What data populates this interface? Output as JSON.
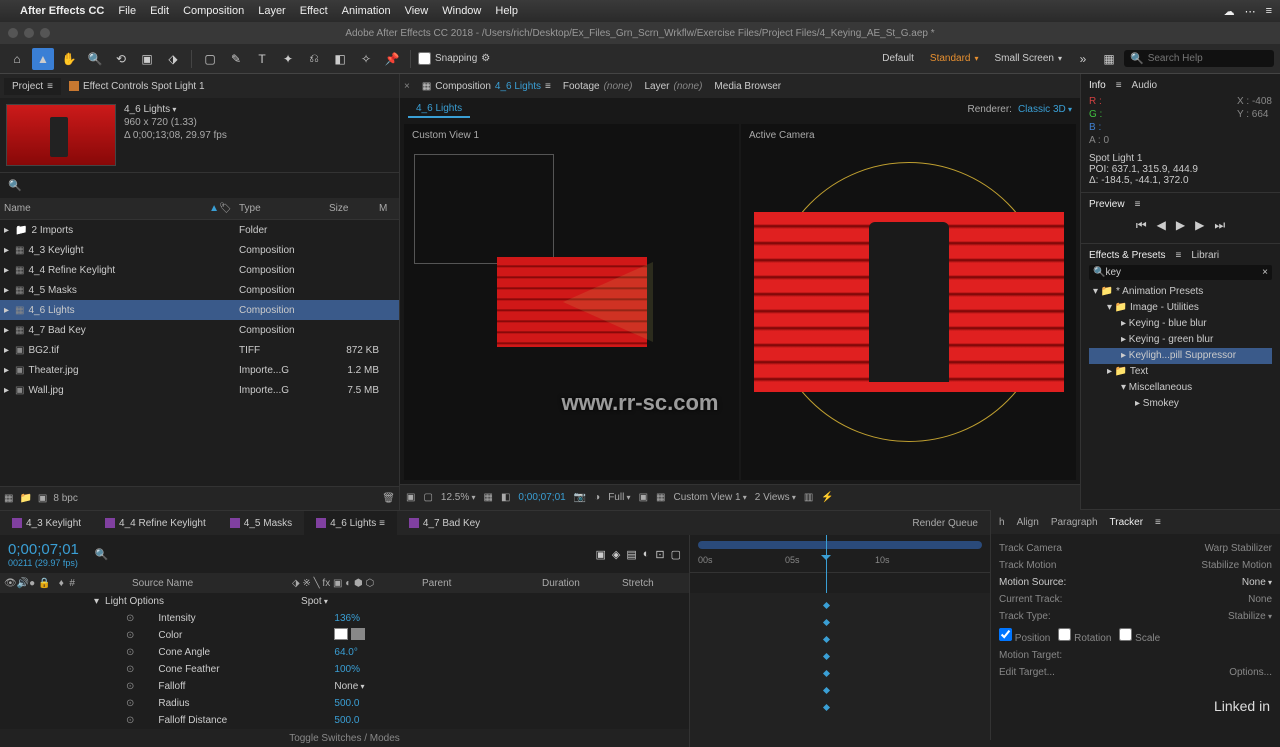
{
  "menubar": {
    "app": "After Effects CC",
    "items": [
      "File",
      "Edit",
      "Composition",
      "Layer",
      "Effect",
      "Animation",
      "View",
      "Window",
      "Help"
    ]
  },
  "titlebar": "Adobe After Effects CC 2018 - /Users/rich/Desktop/Ex_Files_Grn_Scrn_Wrkflw/Exercise Files/Project Files/4_Keying_AE_St_G.aep *",
  "toolbar": {
    "snapping": "Snapping",
    "workspace": "Default",
    "layout": "Standard",
    "screen": "Small Screen",
    "search_ph": "Search Help"
  },
  "project": {
    "tab1": "Project",
    "tab2": "Effect Controls Spot Light 1",
    "comp_name": "4_6 Lights",
    "dims": "960 x 720 (1.33)",
    "dur": "Δ 0;00;13;08, 29.97 fps",
    "cols": {
      "name": "Name",
      "type": "Type",
      "size": "Size",
      "m": "M"
    },
    "items": [
      {
        "name": "2 Imports",
        "type": "Folder",
        "size": "",
        "icon": "folder",
        "sw": "orange"
      },
      {
        "name": "4_3 Keylight",
        "type": "Composition",
        "size": "",
        "icon": "comp",
        "sw": "purple"
      },
      {
        "name": "4_4 Refine Keylight",
        "type": "Composition",
        "size": "",
        "icon": "comp",
        "sw": "purple"
      },
      {
        "name": "4_5 Masks",
        "type": "Composition",
        "size": "",
        "icon": "comp",
        "sw": "purple"
      },
      {
        "name": "4_6 Lights",
        "type": "Composition",
        "size": "",
        "icon": "comp",
        "sw": "purple",
        "sel": true
      },
      {
        "name": "4_7 Bad Key",
        "type": "Composition",
        "size": "",
        "icon": "comp",
        "sw": "purple"
      },
      {
        "name": "BG2.tif",
        "type": "TIFF",
        "size": "872 KB",
        "icon": "img",
        "sw": "pink"
      },
      {
        "name": "Theater.jpg",
        "type": "Importe...G",
        "size": "1.2 MB",
        "icon": "img",
        "sw": "green"
      },
      {
        "name": "Wall.jpg",
        "type": "Importe...G",
        "size": "7.5 MB",
        "icon": "img",
        "sw": "green"
      }
    ],
    "bpc": "8 bpc"
  },
  "viewer": {
    "tabs": [
      {
        "prefix": "Composition",
        "name": "4_6 Lights",
        "active": true
      },
      {
        "prefix": "Footage",
        "name": "(none)"
      },
      {
        "prefix": "Layer",
        "name": "(none)"
      },
      {
        "prefix": "",
        "name": "Media Browser"
      }
    ],
    "subtab": "4_6 Lights",
    "renderer_lbl": "Renderer:",
    "renderer": "Classic 3D",
    "left_view": "Custom View 1",
    "right_view": "Active Camera",
    "footer": {
      "zoom": "12.5%",
      "res": "Full",
      "tc": "0;00;07;01",
      "view": "Custom View 1",
      "nviews": "2 Views"
    }
  },
  "info": {
    "tabs": [
      "Info",
      "Audio"
    ],
    "r": "R :",
    "g": "G :",
    "b": "B :",
    "a": "A : 0",
    "x": "X : -408",
    "y": "Y : 664",
    "light": "Spot Light 1",
    "poi": "POI: 637.1, 315.9, 444.9",
    "delta": "Δ: -184.5, -44.1, 372.0"
  },
  "preview": {
    "title": "Preview"
  },
  "effects": {
    "title": "Effects & Presets",
    "other": "Librari",
    "search": "key",
    "tree": [
      {
        "label": "* Animation Presets",
        "lvl": 0,
        "open": true
      },
      {
        "label": "Image - Utilities",
        "lvl": 1,
        "open": true
      },
      {
        "label": "Keying - blue blur",
        "lvl": 2
      },
      {
        "label": "Keying - green blur",
        "lvl": 2
      },
      {
        "label": "Keyligh...pill Suppressor",
        "lvl": 2,
        "sel": true
      },
      {
        "label": "Text",
        "lvl": 1,
        "open": false
      },
      {
        "label": "Miscellaneous",
        "lvl": 2,
        "open": true
      },
      {
        "label": "Smokey",
        "lvl": 3
      }
    ]
  },
  "timeline": {
    "tabs": [
      {
        "name": "4_3 Keylight"
      },
      {
        "name": "4_4 Refine Keylight"
      },
      {
        "name": "4_5 Masks"
      },
      {
        "name": "4_6 Lights",
        "active": true
      },
      {
        "name": "4_7 Bad Key"
      },
      {
        "name": "Render Queue",
        "plain": true
      }
    ],
    "tc": "0;00;07;01",
    "tc_sub": "00211 (29.97 fps)",
    "cols": {
      "src": "Source Name",
      "parent": "Parent",
      "duration": "Duration",
      "stretch": "Stretch"
    },
    "ticks": [
      "00s",
      "05s",
      "10s"
    ],
    "layers": {
      "group": "Light Options",
      "type": "Spot",
      "props": [
        {
          "name": "Intensity",
          "val": "136%"
        },
        {
          "name": "Color",
          "val": "",
          "color": true
        },
        {
          "name": "Cone Angle",
          "val": "64.0°"
        },
        {
          "name": "Cone Feather",
          "val": "100%"
        },
        {
          "name": "Falloff",
          "val": "None",
          "dd": true
        },
        {
          "name": "Radius",
          "val": "500.0"
        },
        {
          "name": "Falloff Distance",
          "val": "500.0"
        }
      ]
    },
    "toggle": "Toggle Switches / Modes"
  },
  "tracker": {
    "tabs": [
      "h",
      "Align",
      "Paragraph",
      "Tracker"
    ],
    "rows": [
      [
        "Track Camera",
        "Warp Stabilizer"
      ],
      [
        "Track Motion",
        "Stabilize Motion"
      ]
    ],
    "src_lbl": "Motion Source:",
    "src": "None",
    "cur_lbl": "Current Track:",
    "cur": "None",
    "type_lbl": "Track Type:",
    "type": "Stabilize",
    "pos": "Position",
    "rot": "Rotation",
    "scale": "Scale",
    "target_lbl": "Motion Target:",
    "edit": "Edit Target...",
    "opts": "Options...",
    "brand": "Linked in"
  },
  "watermark": "www.rr-sc.com"
}
